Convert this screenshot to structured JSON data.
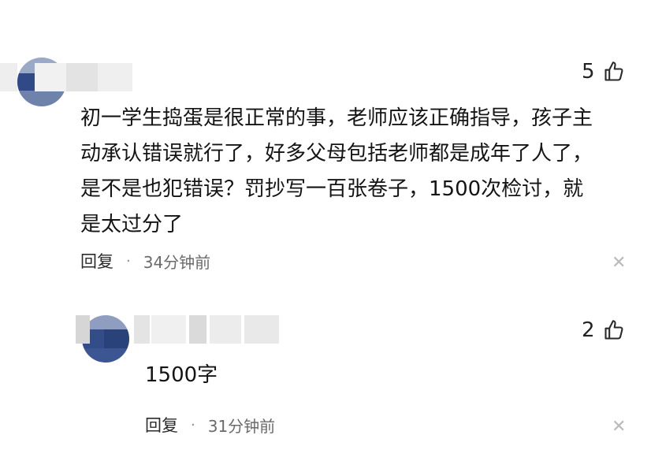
{
  "comments": [
    {
      "likes": "5",
      "text_lines": [
        "初一学生捣蛋是很正常的事，老师应该正确指导，孩子主",
        "动承认错误就行了，好多父母包括老师都是成年了人了，",
        "是不是也犯错误？罚抄写一百张卷子，1500次检讨，就",
        "是太过分了"
      ],
      "reply_label": "回复",
      "separator": "·",
      "time": "34分钟前"
    },
    {
      "likes": "2",
      "text_lines": [
        "1500字"
      ],
      "reply_label": "回复",
      "separator": "·",
      "time": "31分钟前"
    }
  ],
  "icons": {
    "like": "thumbs-up-icon",
    "close": "close-icon"
  },
  "colors": {
    "avatar_primary": "#2f4a87",
    "avatar_light": "#b7c1d6",
    "mosaic": "#d9d9d9"
  }
}
